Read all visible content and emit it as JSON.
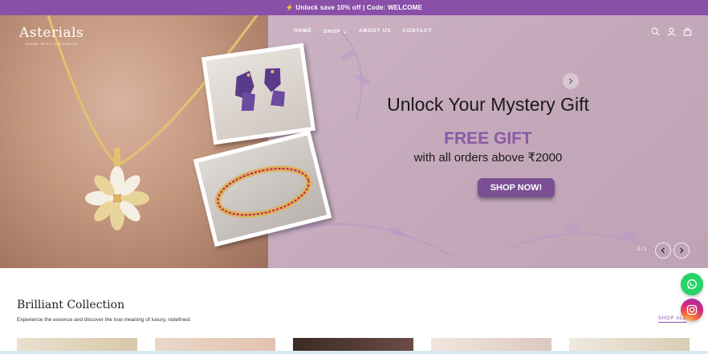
{
  "announcement": {
    "text": "⚡ Unlock save 10% off | Code: WELCOME"
  },
  "brand": {
    "name": "Asterials",
    "tagline": "SHINE WITH ELEGANCE"
  },
  "nav": {
    "items": [
      {
        "label": "HOME"
      },
      {
        "label": "SHOP ⌄"
      },
      {
        "label": "ABOUT US"
      },
      {
        "label": "CONTACT"
      }
    ]
  },
  "header_icons": [
    "search-icon",
    "account-icon",
    "cart-icon"
  ],
  "hero": {
    "title": "Unlock Your Mystery Gift",
    "highlight": "FREE GIFT",
    "subtitle": "with all orders above ₹2000",
    "cta_label": "SHOP NOW!",
    "slide_counter": "2 / 2"
  },
  "section": {
    "title": "Brilliant Collection",
    "description": "Experience the essence and discover the true meaning of luxury, redefined.",
    "link_label": "SHOP ALL"
  },
  "colors": {
    "brand_purple": "#8a4fa8",
    "hero_bg": "#c4a9bb",
    "cta_bg": "#7b4f93",
    "highlight_text": "#8a59a6"
  }
}
